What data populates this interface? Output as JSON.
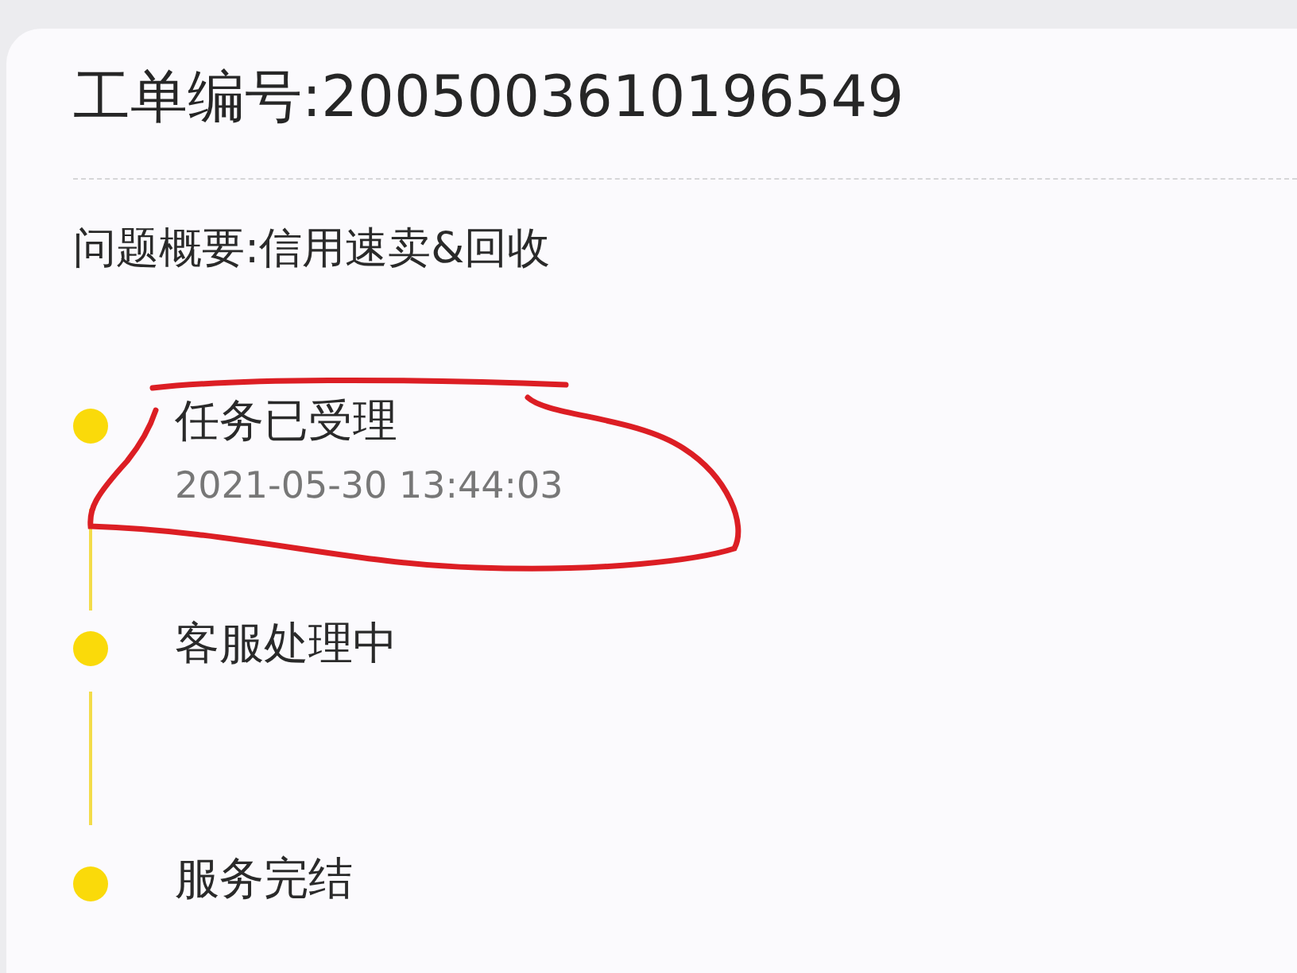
{
  "ticket": {
    "number_line": "工单编号:2005003610196549",
    "summary": "问题概要:信用速卖&回收"
  },
  "steps": [
    {
      "title": "任务已受理",
      "time": "2021-05-30 13:44:03"
    },
    {
      "title": "客服处理中"
    },
    {
      "title": "服务完结"
    }
  ],
  "annotation": {
    "kind": "freehand-loop"
  }
}
